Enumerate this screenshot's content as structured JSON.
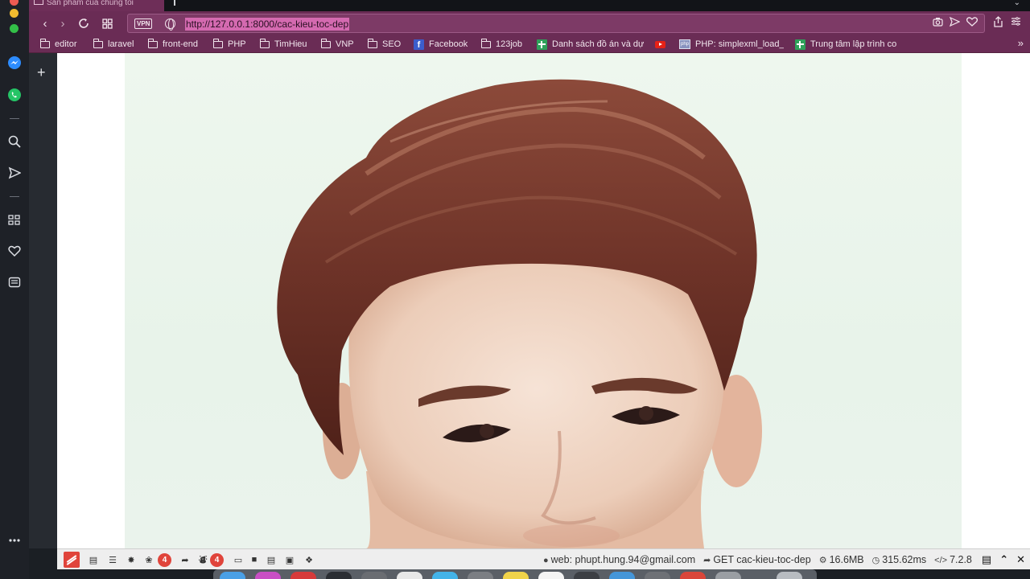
{
  "window": {
    "tab_title": "Sản phẩm của chúng tôi"
  },
  "navigation": {
    "vpn_badge": "VPN",
    "url": "http://127.0.0.1:8000/cac-kieu-toc-dep"
  },
  "bookmarks": [
    {
      "label": "editor",
      "icon": "folder-icon"
    },
    {
      "label": "laravel",
      "icon": "folder-icon"
    },
    {
      "label": "front-end",
      "icon": "folder-icon"
    },
    {
      "label": "PHP",
      "icon": "folder-icon"
    },
    {
      "label": "TimHieu",
      "icon": "folder-icon"
    },
    {
      "label": "VNP",
      "icon": "folder-icon"
    },
    {
      "label": "SEO",
      "icon": "folder-icon"
    },
    {
      "label": "Facebook",
      "icon": "facebook-icon"
    },
    {
      "label": "123job",
      "icon": "folder-icon"
    },
    {
      "label": "Danh sách đồ án và dự",
      "icon": "sheets-icon"
    },
    {
      "label": "",
      "icon": "youtube-icon"
    },
    {
      "label": "PHP: simplexml_load_",
      "icon": "php-icon"
    },
    {
      "label": "Trung tâm lập trình co",
      "icon": "sheets-icon"
    }
  ],
  "debugbar": {
    "badge_1": "4",
    "badge_2": "4",
    "user": "web: phupt.hung.94@gmail.com",
    "route": "GET cac-kieu-toc-dep",
    "memory": "16.6MB",
    "time": "315.62ms",
    "version": "7.2.8"
  },
  "colors": {
    "browser_accent": "#6a2c55",
    "url_highlight": "#d46ab0",
    "debugbar_badge": "#e0443b"
  }
}
